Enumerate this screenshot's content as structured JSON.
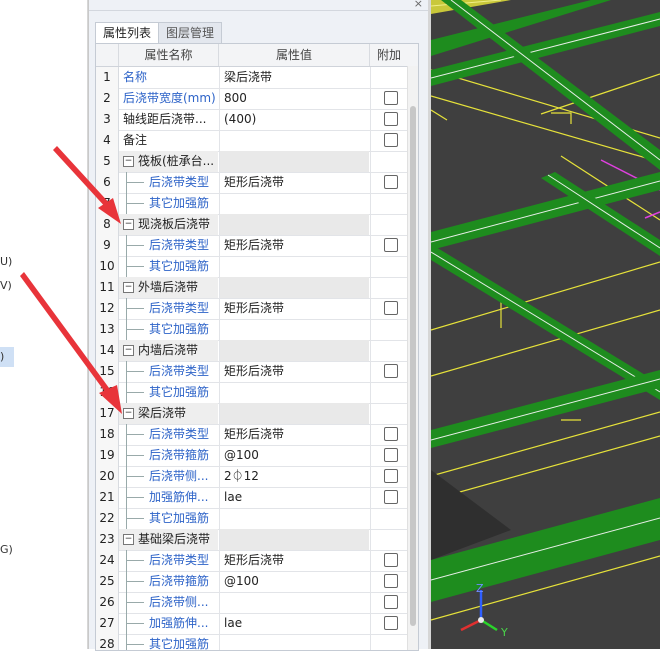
{
  "left_fragments": [
    "U)",
    "V)",
    ")",
    "G)"
  ],
  "panel": {
    "close_glyph": "×",
    "tabs": [
      "属性列表",
      "图层管理"
    ],
    "headers": {
      "name": "属性名称",
      "value": "属性值",
      "add": "附加"
    },
    "rows": [
      {
        "num": "1",
        "name": "名称",
        "value": "梁后浇带",
        "style": "link",
        "checkbox": false
      },
      {
        "num": "2",
        "name": "后浇带宽度(mm)",
        "value": "800",
        "style": "link",
        "checkbox": true
      },
      {
        "num": "3",
        "name": "轴线距后浇带...",
        "value": "(400)",
        "style": "plain",
        "checkbox": true
      },
      {
        "num": "4",
        "name": "备注",
        "value": "",
        "style": "plain",
        "checkbox": true
      },
      {
        "num": "5",
        "name": "筏板(桩承台...",
        "value": "",
        "style": "group",
        "checkbox": false
      },
      {
        "num": "6",
        "name": "后浇带类型",
        "value": "矩形后浇带",
        "style": "child",
        "checkbox": true
      },
      {
        "num": "7",
        "name": "其它加强筋",
        "value": "",
        "style": "child",
        "checkbox": false
      },
      {
        "num": "8",
        "name": "现浇板后浇带",
        "value": "",
        "style": "group",
        "checkbox": false
      },
      {
        "num": "9",
        "name": "后浇带类型",
        "value": "矩形后浇带",
        "style": "child",
        "checkbox": true
      },
      {
        "num": "10",
        "name": "其它加强筋",
        "value": "",
        "style": "child",
        "checkbox": false
      },
      {
        "num": "11",
        "name": "外墙后浇带",
        "value": "",
        "style": "group",
        "checkbox": false
      },
      {
        "num": "12",
        "name": "后浇带类型",
        "value": "矩形后浇带",
        "style": "child",
        "checkbox": true
      },
      {
        "num": "13",
        "name": "其它加强筋",
        "value": "",
        "style": "child",
        "checkbox": false
      },
      {
        "num": "14",
        "name": "内墙后浇带",
        "value": "",
        "style": "group",
        "checkbox": false
      },
      {
        "num": "15",
        "name": "后浇带类型",
        "value": "矩形后浇带",
        "style": "child",
        "checkbox": true
      },
      {
        "num": "16",
        "name": "其它加强筋",
        "value": "",
        "style": "child",
        "checkbox": false
      },
      {
        "num": "17",
        "name": "梁后浇带",
        "value": "",
        "style": "group",
        "checkbox": false
      },
      {
        "num": "18",
        "name": "后浇带类型",
        "value": "矩形后浇带",
        "style": "child",
        "checkbox": true
      },
      {
        "num": "19",
        "name": "后浇带箍筋",
        "value": "@100",
        "style": "child",
        "checkbox": true
      },
      {
        "num": "20",
        "name": "后浇带侧...",
        "value": "2⏀12",
        "style": "child",
        "checkbox": true
      },
      {
        "num": "21",
        "name": "加强筋伸...",
        "value": "lae",
        "style": "child",
        "checkbox": true
      },
      {
        "num": "22",
        "name": "其它加强筋",
        "value": "",
        "style": "child",
        "checkbox": false
      },
      {
        "num": "23",
        "name": "基础梁后浇带",
        "value": "",
        "style": "group",
        "checkbox": false
      },
      {
        "num": "24",
        "name": "后浇带类型",
        "value": "矩形后浇带",
        "style": "child",
        "checkbox": true
      },
      {
        "num": "25",
        "name": "后浇带箍筋",
        "value": "@100",
        "style": "child",
        "checkbox": true
      },
      {
        "num": "26",
        "name": "后浇带侧...",
        "value": "",
        "style": "child",
        "checkbox": true
      },
      {
        "num": "27",
        "name": "加强筋伸...",
        "value": "lae",
        "style": "child",
        "checkbox": true
      },
      {
        "num": "28",
        "name": "其它加强筋",
        "value": "",
        "style": "child",
        "checkbox": false
      }
    ],
    "toggle_glyph": "−"
  },
  "viewport": {
    "axis_labels": {
      "z": "Z",
      "y": "Y"
    },
    "colors": {
      "background": "#3f3f3f",
      "beam": "#1e8c1e",
      "beam_edge": "#dfe8df",
      "line": "#e6e23a",
      "accent": "#e040e0",
      "arrow": "#e8343a"
    }
  }
}
